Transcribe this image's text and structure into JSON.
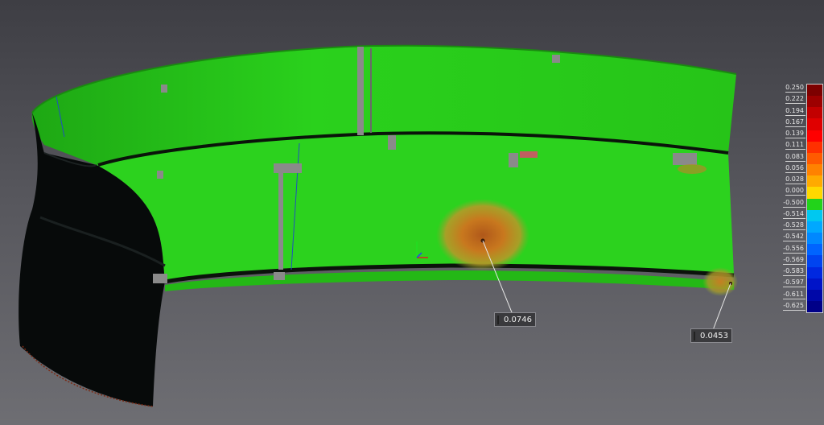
{
  "viewport": {
    "colors": {
      "background_top": "#3e3e44",
      "background_bottom": "#6e6e73",
      "surface_green": "#2ad11c",
      "surface_dark": "#070a0a",
      "deviation_orange": "#c8781e",
      "no_data_gray": "#8a8a8a"
    }
  },
  "callouts": [
    {
      "value": "0.0746",
      "color": "#ff8c00"
    },
    {
      "value": "0.0453",
      "color": "#ffa000"
    }
  ],
  "color_scale": {
    "labels": [
      "0.250",
      "0.222",
      "0.194",
      "0.167",
      "0.139",
      "0.111",
      "0.083",
      "0.056",
      "0.028",
      "0.000",
      "-0.500",
      "-0.514",
      "-0.528",
      "-0.542",
      "-0.556",
      "-0.569",
      "-0.583",
      "-0.597",
      "-0.611",
      "-0.625"
    ],
    "colors": [
      "#7d0000",
      "#9d0000",
      "#c20000",
      "#e00000",
      "#ff0000",
      "#ff3000",
      "#ff5a00",
      "#ff8200",
      "#ffaa00",
      "#ffd800",
      "#22d31a",
      "#00c8f0",
      "#00a8ff",
      "#0088ff",
      "#0064ff",
      "#0044f0",
      "#0028e0",
      "#0014c8",
      "#0008a8",
      "#000088"
    ]
  }
}
